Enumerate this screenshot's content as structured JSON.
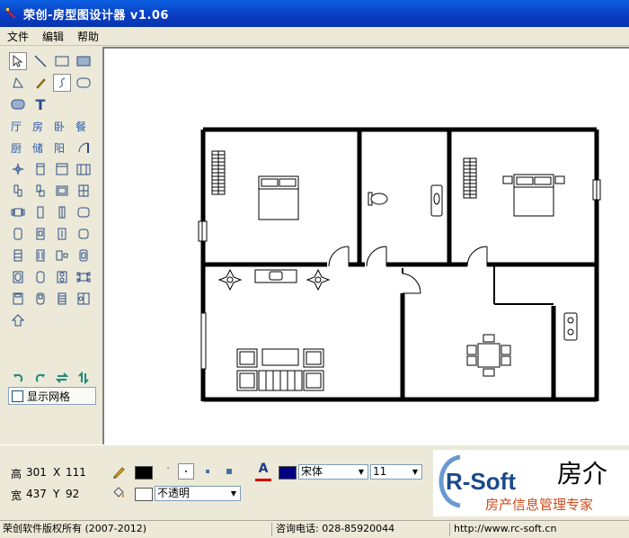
{
  "window": {
    "title": "荣创-房型图设计器 v1.06"
  },
  "menu": {
    "items": [
      "文件",
      "编辑",
      "帮助"
    ]
  },
  "toolbox": {
    "text_tools": {
      "t": "T",
      "living": "厅",
      "room": "房",
      "bedroom": "卧",
      "dining": "餐",
      "kitchen": "厨",
      "storage": "储",
      "balcony": "阳"
    },
    "show_grid": "显示网格"
  },
  "dimensions": {
    "height_label": "高",
    "height_value": "301",
    "x_label": "X",
    "x_value": "111",
    "width_label": "宽",
    "width_value": "437",
    "y_label": "Y",
    "y_value": "92"
  },
  "style": {
    "stroke_color": "#000000",
    "fill_color": "#ffffff",
    "text_color": "#000080",
    "opacity": "不透明",
    "font_name": "宋体",
    "font_size": "11"
  },
  "logo": {
    "brand": "R-Soft",
    "title": "房介",
    "subtitle": "房产信息管理专家"
  },
  "status": {
    "copyright": "荣创软件版权所有 (2007-2012)",
    "phone": "咨询电话: 028-85920044",
    "url": "http://www.rc-soft.cn"
  }
}
